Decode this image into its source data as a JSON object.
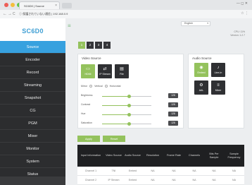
{
  "browser": {
    "tab_title": "SC6D0 | Source",
    "tab_close": "×",
    "window_controls": "— ◻ ✕",
    "back": "←",
    "forward": "→",
    "reload": "C",
    "url": "ⓘ 保護されていない通信 | 192.168.0.9",
    "menu": "☆ ⋮"
  },
  "app": {
    "logo": "SC6D0",
    "hamburger": "≡",
    "language": "English",
    "language_caret": "▾",
    "cpu": "CPU: 11%",
    "version": "Version: 1.2.7"
  },
  "sidebar": {
    "items": [
      {
        "label": "Source",
        "active": true
      },
      {
        "label": "Encoder"
      },
      {
        "label": "Record"
      },
      {
        "label": "Streaming"
      },
      {
        "label": "Snapshot"
      },
      {
        "label": "CG"
      },
      {
        "label": "PGM"
      },
      {
        "label": "Mixer"
      },
      {
        "label": "Monitor"
      },
      {
        "label": "System"
      },
      {
        "label": "Status"
      }
    ]
  },
  "channel_tabs": [
    "1",
    "2",
    "3",
    "4"
  ],
  "video_source": {
    "title": "Video Source",
    "buttons": [
      {
        "label": "HDMI",
        "icon": "hdmi-port-icon",
        "glyph": "▭",
        "active": true
      },
      {
        "label": "IP Stream",
        "icon": "ip-stream-icon",
        "glyph": "⇄"
      },
      {
        "label": "File",
        "icon": "file-icon",
        "glyph": "▤"
      }
    ],
    "mirror_label": "Mirror",
    "mirror_options": [
      "Vertical",
      "Horizontal"
    ],
    "sliders": [
      {
        "label": "Brightness",
        "value": "128",
        "fraction": 0.55
      },
      {
        "label": "Contrast",
        "value": "128",
        "fraction": 0.55
      },
      {
        "label": "Hue",
        "value": "128",
        "fraction": 0.55
      },
      {
        "label": "Saturation",
        "value": "128",
        "fraction": 0.55
      }
    ]
  },
  "audio_source": {
    "title": "Audio Source",
    "buttons": [
      {
        "label": "Embed",
        "icon": "embed-audio-icon",
        "glyph": "◉",
        "active": true
      },
      {
        "label": "Line-In",
        "icon": "line-in-icon",
        "glyph": "♪"
      },
      {
        "label": "AAL",
        "icon": "aal-icon",
        "glyph": "⚙"
      },
      {
        "label": "Mixer",
        "icon": "mixer-icon",
        "glyph": "≡"
      }
    ]
  },
  "actions": {
    "apply": "Apply",
    "reset": "Reset"
  },
  "table": {
    "headers": [
      "Input Information",
      "Video Source",
      "Audio Source",
      "Resolution",
      "Frame Rate",
      "Channels",
      "Bits Per Sample",
      "Sample Frequency"
    ],
    "rows": [
      [
        "Channel 1",
        "TNI",
        "Embed",
        "NA",
        "NA",
        "NA",
        "NA",
        "NA"
      ],
      [
        "Channel 2",
        "IP Stream",
        "Embed",
        "NA",
        "NA",
        "NA",
        "NA",
        "NA"
      ]
    ]
  },
  "colors": {
    "accent_green": "#94c25d",
    "active_blue": "#37a1df",
    "sidebar_dark": "#2c2d2f"
  }
}
